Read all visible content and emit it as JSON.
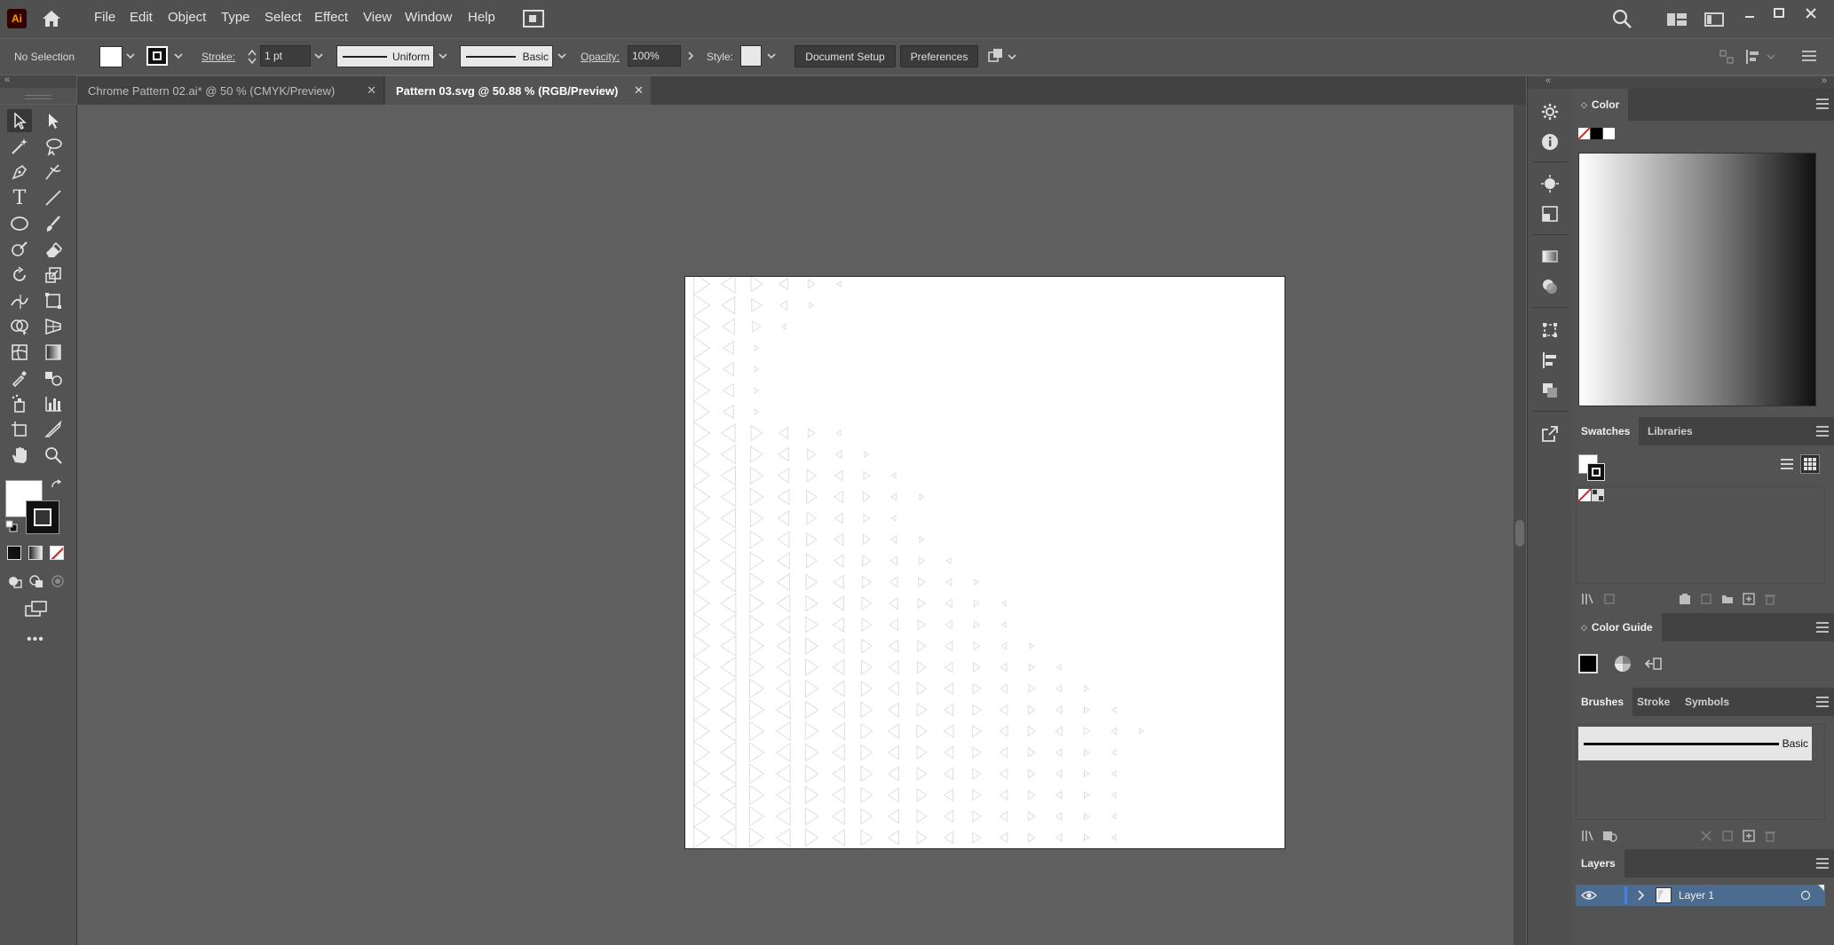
{
  "app": {
    "logo": "Ai",
    "brand_color": "#ff9a00",
    "logo_bg": "#330000"
  },
  "menu": [
    "File",
    "Edit",
    "Object",
    "Type",
    "Select",
    "Effect",
    "View",
    "Window",
    "Help"
  ],
  "control_bar": {
    "selection": "No Selection",
    "stroke_label": "Stroke:",
    "stroke_weight": "1 pt",
    "profile": "Uniform",
    "brush": "Basic",
    "opacity_label": "Opacity:",
    "opacity": "100%",
    "style_label": "Style:",
    "document_setup": "Document Setup",
    "preferences": "Preferences"
  },
  "tabs": [
    {
      "label": "Chrome Pattern 02.ai* @ 50 % (CMYK/Preview)",
      "active": false
    },
    {
      "label": "Pattern 03.svg @ 50.88 % (RGB/Preview)",
      "active": true
    }
  ],
  "panels": {
    "color": {
      "title": "Color"
    },
    "swatches": {
      "tabs": [
        "Swatches",
        "Libraries"
      ]
    },
    "color_guide": {
      "title": "Color Guide"
    },
    "brushes": {
      "tabs": [
        "Brushes",
        "Stroke",
        "Symbols"
      ],
      "brush_name": "Basic"
    },
    "layers": {
      "title": "Layers",
      "items": [
        {
          "name": "Layer 1",
          "color": "#4d7fd6"
        }
      ]
    }
  },
  "toolbar": {
    "more": "•••"
  }
}
